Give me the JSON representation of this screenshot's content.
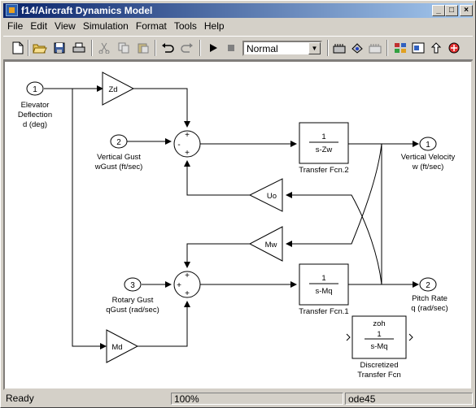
{
  "window": {
    "title": "f14/Aircraft Dynamics Model"
  },
  "menu": [
    "File",
    "Edit",
    "View",
    "Simulation",
    "Format",
    "Tools",
    "Help"
  ],
  "toolbar": {
    "sim_mode": "Normal"
  },
  "diagram": {
    "ports_in": [
      {
        "num": "1",
        "label1": "Elevator",
        "label2": "Deflection",
        "label3": "d (deg)"
      },
      {
        "num": "2",
        "label1": "Vertical Gust",
        "label2": "wGust (ft/sec)"
      },
      {
        "num": "3",
        "label1": "Rotary Gust",
        "label2": "qGust (rad/sec)"
      }
    ],
    "ports_out": [
      {
        "num": "1",
        "label1": "Vertical Velocity",
        "label2": "w (ft/sec)"
      },
      {
        "num": "2",
        "label1": "Pitch Rate",
        "label2": "q (rad/sec)"
      }
    ],
    "gains": {
      "zd": "Zd",
      "uo": "Uo",
      "mw": "Mw",
      "md": "Md"
    },
    "tf2": {
      "num": "1",
      "den": "s-Zw",
      "name": "Transfer Fcn.2"
    },
    "tf1": {
      "num": "1",
      "den": "s-Mq",
      "name": "Transfer Fcn.1"
    },
    "dtf": {
      "zoh": "zoh",
      "num": "1",
      "den": "s-Mq",
      "name1": "Discretized",
      "name2": "Transfer Fcn"
    },
    "sum_signs": {
      "plus": "+",
      "minus": "-"
    }
  },
  "status": {
    "state": "Ready",
    "zoom": "100%",
    "solver": "ode45"
  }
}
